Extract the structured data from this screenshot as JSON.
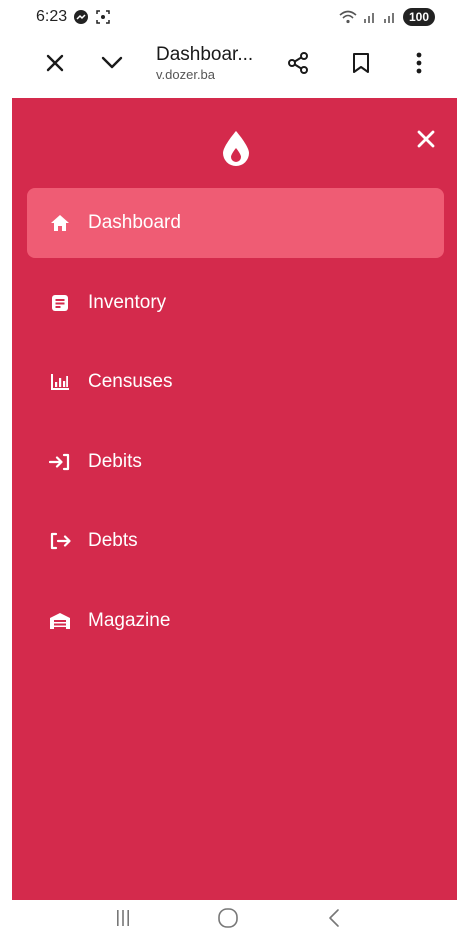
{
  "status_bar": {
    "time": "6:23",
    "battery": "100",
    "icons": [
      "messenger-icon",
      "screenshot-icon",
      "wifi-icon",
      "signal-icon",
      "signal-icon-2"
    ]
  },
  "browser": {
    "page_title": "Dashboar...",
    "page_url": "v.dozer.ba",
    "icons": [
      "close-icon",
      "chevron-down-icon",
      "share-icon",
      "bookmark-icon",
      "more-vert-icon"
    ]
  },
  "sidebar": {
    "background_color": "#d42a4c",
    "active_color": "#ef5c74",
    "logo_icon": "drop-logo-icon",
    "close_icon": "close-icon",
    "items": [
      {
        "label": "Dashboard",
        "icon": "home-icon",
        "active": true
      },
      {
        "label": "Inventory",
        "icon": "clipboard-icon",
        "active": false
      },
      {
        "label": "Censuses",
        "icon": "bar-chart-icon",
        "active": false
      },
      {
        "label": "Debits",
        "icon": "login-arrow-icon",
        "active": false
      },
      {
        "label": "Debts",
        "icon": "logout-arrow-icon",
        "active": false
      },
      {
        "label": "Magazine",
        "icon": "warehouse-icon",
        "active": false
      }
    ]
  },
  "android_nav": {
    "icons": [
      "recents-icon",
      "home-circle-icon",
      "back-icon"
    ]
  }
}
